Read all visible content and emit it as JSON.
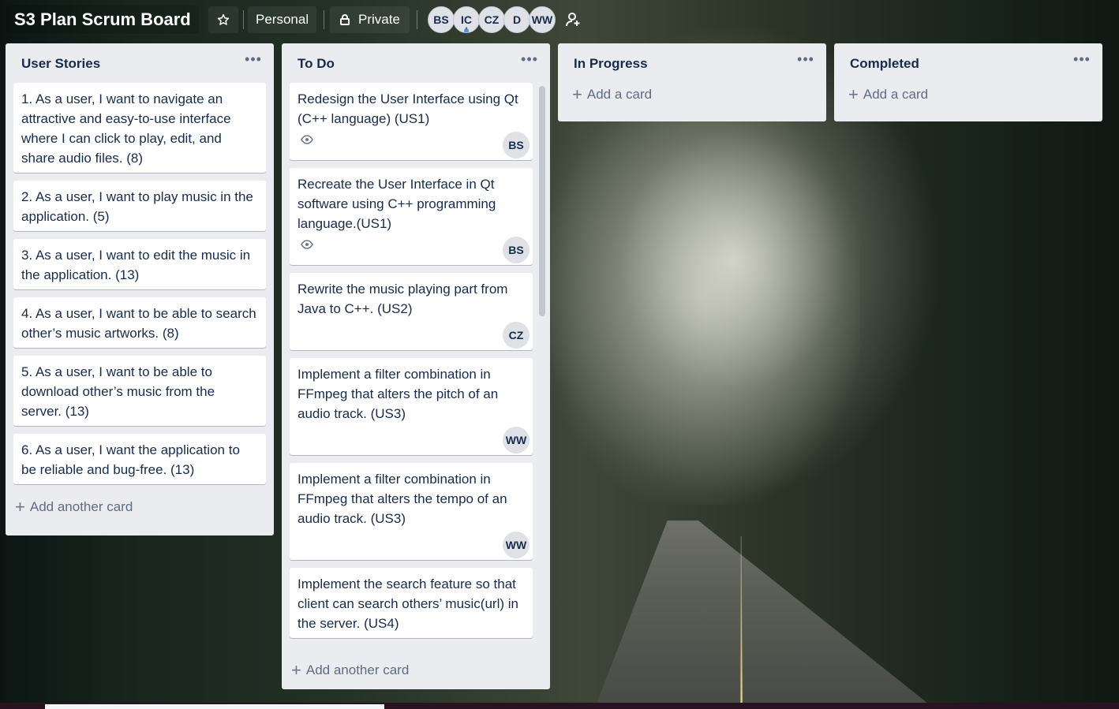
{
  "board": {
    "title": "S3 Plan Scrum Board",
    "team_label": "Personal",
    "visibility_label": "Private",
    "members": [
      {
        "initials": "BS"
      },
      {
        "initials": "IC"
      },
      {
        "initials": "CZ"
      },
      {
        "initials": "D"
      },
      {
        "initials": "WW"
      }
    ]
  },
  "lists": {
    "user_stories": {
      "title": "User Stories",
      "add_label": "Add another card",
      "cards": [
        {
          "text": "1. As a user, I want to navigate an attractive and easy-to-use interface where I can click to play, edit, and share audio files. (8)"
        },
        {
          "text": "2. As a user, I want to play music in the application. (5)"
        },
        {
          "text": "3. As a user, I want to edit the music in the application. (13)"
        },
        {
          "text": "4. As a user, I want to be able to search other’s music artworks. (8)"
        },
        {
          "text": "5. As a user, I want to be able to download other’s music from the server. (13)"
        },
        {
          "text": "6. As a user, I want the application to be reliable and bug-free. (13)"
        }
      ]
    },
    "todo": {
      "title": "To Do",
      "add_label": "Add another card",
      "cards": [
        {
          "text": "Redesign the User Interface using Qt (C++ language) (US1)",
          "member": "BS"
        },
        {
          "text": "Recreate the User Interface in Qt software using C++ programming language.(US1)",
          "member": "BS"
        },
        {
          "text": "Rewrite the music playing part from Java to C++. (US2)",
          "member": "CZ"
        },
        {
          "text": "Implement a filter combination in FFmpeg that alters the pitch of an audio track. (US3)",
          "member": "WW"
        },
        {
          "text": "Implement a filter combination in FFmpeg that alters the tempo of an audio track. (US3)",
          "member": "WW"
        },
        {
          "text": "Implement the search feature so that client can search others’ music(url) in the server. (US4)"
        }
      ]
    },
    "in_progress": {
      "title": "In Progress",
      "add_label": "Add a card"
    },
    "completed": {
      "title": "Completed",
      "add_label": "Add a card"
    }
  }
}
